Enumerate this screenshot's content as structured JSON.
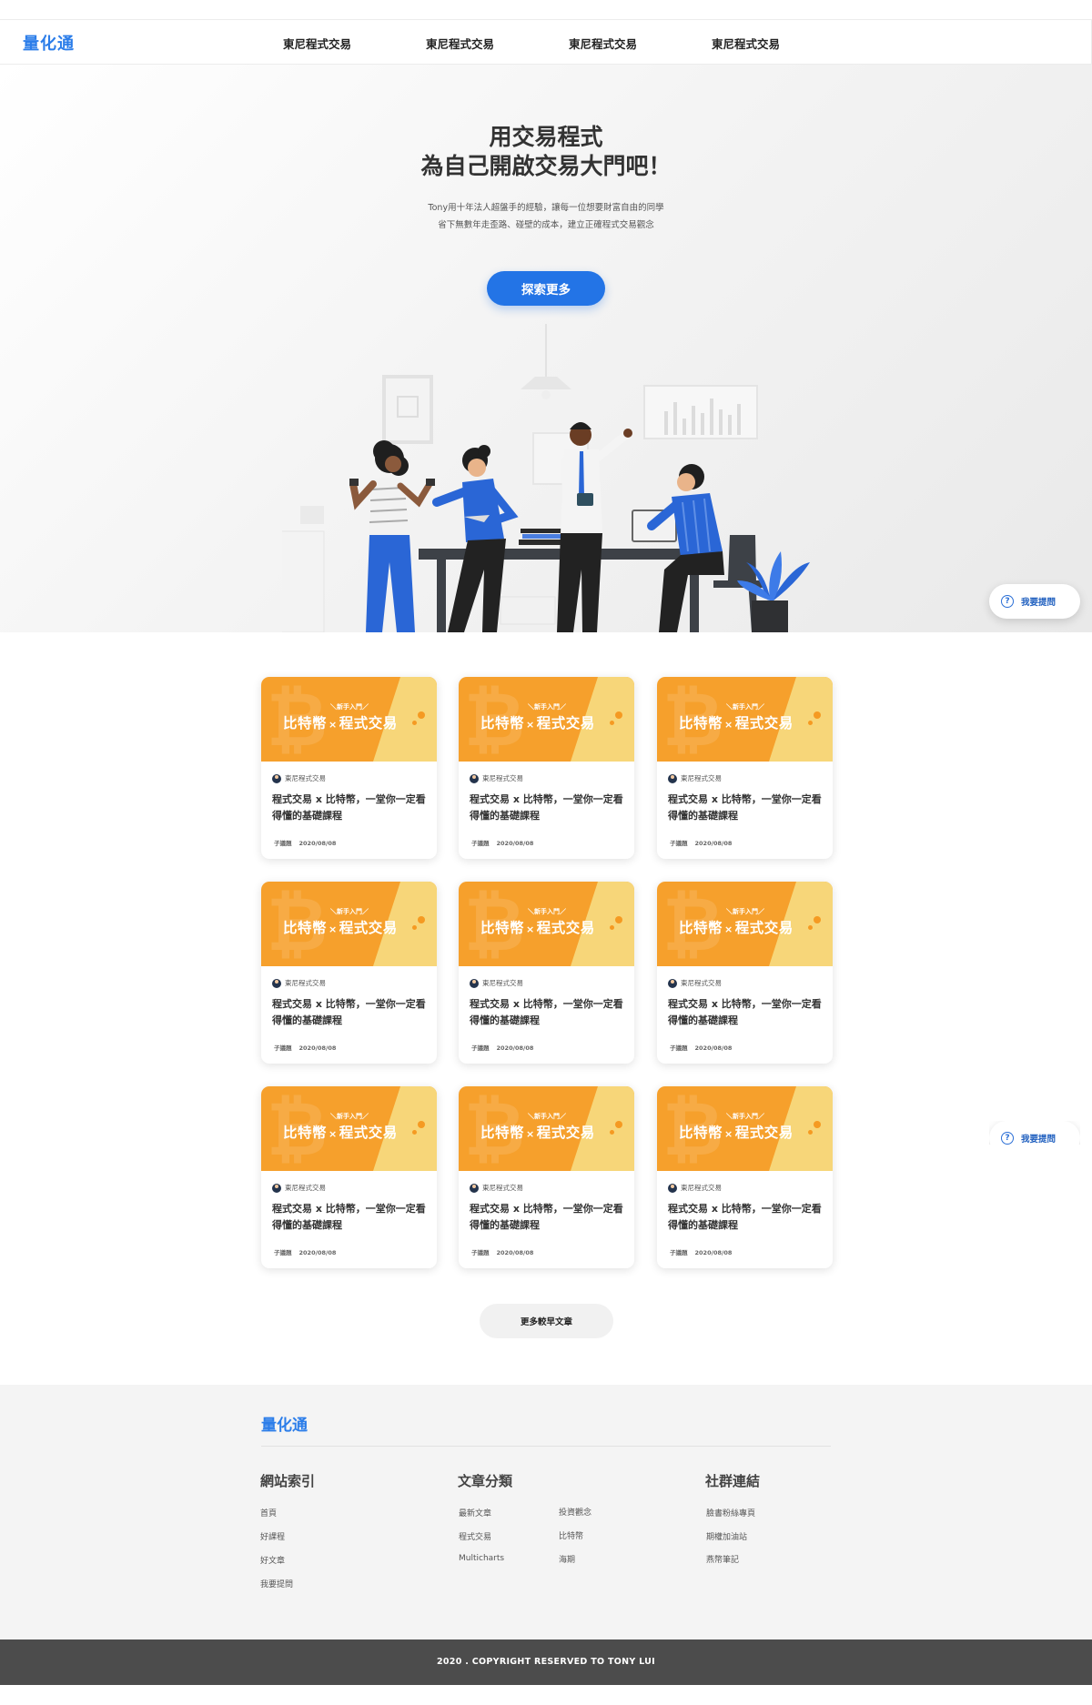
{
  "nav": {
    "logo": "量化通",
    "links": [
      "東尼程式交易",
      "東尼程式交易",
      "東尼程式交易",
      "東尼程式交易"
    ]
  },
  "hero": {
    "title_line1": "用交易程式",
    "title_line2": "為自己開啟交易大門吧！",
    "sub_line1": "Tony用十年法人超盤手的經驗，讓每一位想要財富自由的同學",
    "sub_line2": "省下無數年走歪路、碰壁的成本，建立正確程式交易觀念",
    "cta": "探索更多"
  },
  "ask_button": {
    "label": "我要提問",
    "icon": "question-circle-icon"
  },
  "cards": [
    {
      "tag": "＼新手入門／",
      "banner_a": "比特幣",
      "banner_x": "×",
      "banner_b": "程式交易",
      "author": "東尼程式交易",
      "title": "程式交易 x 比特幣，一堂你一定看得懂的基礎課程",
      "category": "子議題",
      "date": "2020/08/08"
    },
    {
      "tag": "＼新手入門／",
      "banner_a": "比特幣",
      "banner_x": "×",
      "banner_b": "程式交易",
      "author": "東尼程式交易",
      "title": "程式交易 x 比特幣，一堂你一定看得懂的基礎課程",
      "category": "子議題",
      "date": "2020/08/08"
    },
    {
      "tag": "＼新手入門／",
      "banner_a": "比特幣",
      "banner_x": "×",
      "banner_b": "程式交易",
      "author": "東尼程式交易",
      "title": "程式交易 x 比特幣，一堂你一定看得懂的基礎課程",
      "category": "子議題",
      "date": "2020/08/08"
    },
    {
      "tag": "＼新手入門／",
      "banner_a": "比特幣",
      "banner_x": "×",
      "banner_b": "程式交易",
      "author": "東尼程式交易",
      "title": "程式交易 x 比特幣，一堂你一定看得懂的基礎課程",
      "category": "子議題",
      "date": "2020/08/08"
    },
    {
      "tag": "＼新手入門／",
      "banner_a": "比特幣",
      "banner_x": "×",
      "banner_b": "程式交易",
      "author": "東尼程式交易",
      "title": "程式交易 x 比特幣，一堂你一定看得懂的基礎課程",
      "category": "子議題",
      "date": "2020/08/08"
    },
    {
      "tag": "＼新手入門／",
      "banner_a": "比特幣",
      "banner_x": "×",
      "banner_b": "程式交易",
      "author": "東尼程式交易",
      "title": "程式交易 x 比特幣，一堂你一定看得懂的基礎課程",
      "category": "子議題",
      "date": "2020/08/08"
    },
    {
      "tag": "＼新手入門／",
      "banner_a": "比特幣",
      "banner_x": "×",
      "banner_b": "程式交易",
      "author": "東尼程式交易",
      "title": "程式交易 x 比特幣，一堂你一定看得懂的基礎課程",
      "category": "子議題",
      "date": "2020/08/08"
    },
    {
      "tag": "＼新手入門／",
      "banner_a": "比特幣",
      "banner_x": "×",
      "banner_b": "程式交易",
      "author": "東尼程式交易",
      "title": "程式交易 x 比特幣，一堂你一定看得懂的基礎課程",
      "category": "子議題",
      "date": "2020/08/08"
    },
    {
      "tag": "＼新手入門／",
      "banner_a": "比特幣",
      "banner_x": "×",
      "banner_b": "程式交易",
      "author": "東尼程式交易",
      "title": "程式交易 x 比特幣，一堂你一定看得懂的基礎課程",
      "category": "子議題",
      "date": "2020/08/08"
    }
  ],
  "more_button": "更多較早文章",
  "footer": {
    "logo": "量化通",
    "col1": {
      "heading": "網站索引",
      "links": [
        "首頁",
        "好課程",
        "好文章",
        "我要提問"
      ]
    },
    "col2": {
      "heading": "文章分類",
      "links_a": [
        "最新文章",
        "程式交易",
        "Multicharts"
      ],
      "links_b": [
        "投資觀念",
        "比特幣",
        "海期"
      ]
    },
    "col3": {
      "heading": "社群連結",
      "links": [
        "臉書粉絲專頁",
        "期權加油站",
        "燕幣筆記"
      ]
    },
    "copyright": "2020 . COPYRIGHT RESERVED TO TONY LUI"
  },
  "colors": {
    "brand": "#2b7de9",
    "cta": "#2374e6",
    "card_orange": "#f6a02c",
    "card_yellow": "#f7d679",
    "footer_bar": "#4c4c4c"
  }
}
